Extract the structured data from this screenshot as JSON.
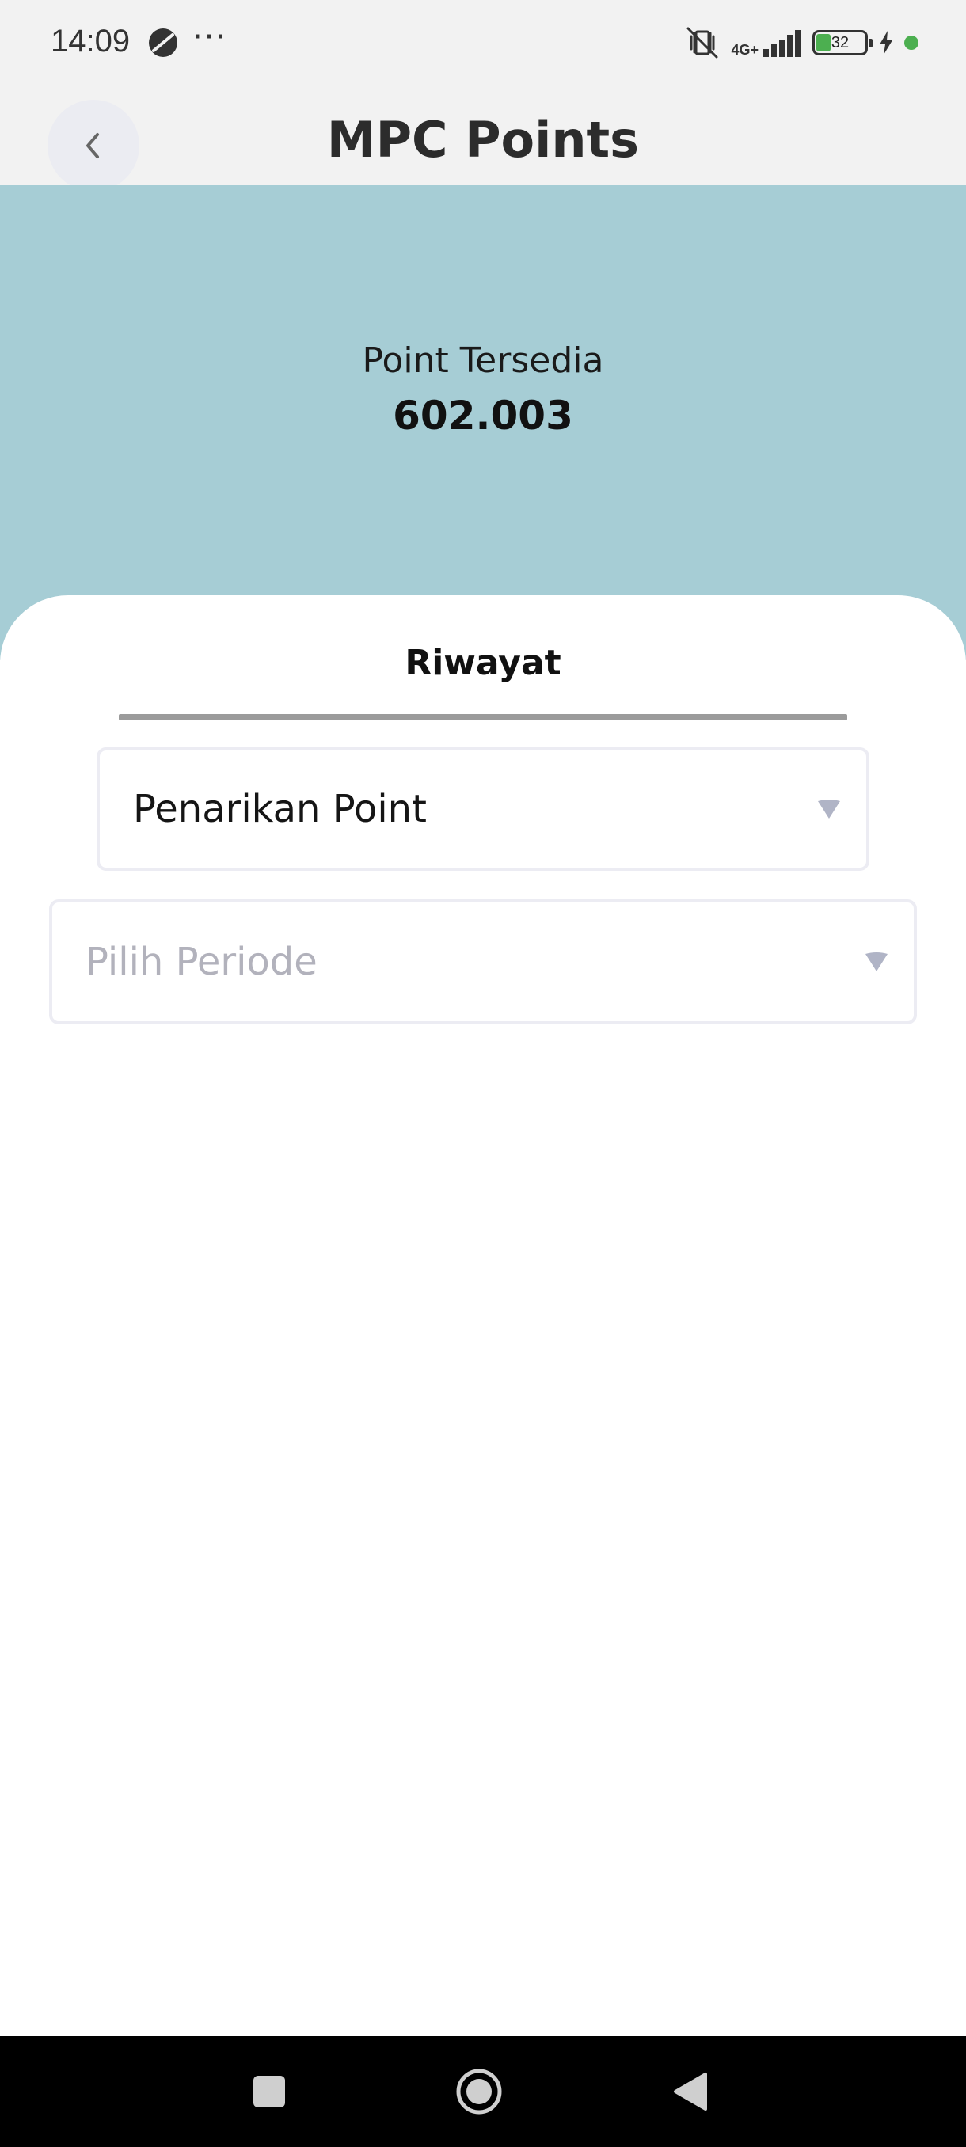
{
  "status_bar": {
    "time": "14:09",
    "more": "···",
    "network": "4G+",
    "battery": "32",
    "icons": [
      "app-icon",
      "silent-icon",
      "signal-icon",
      "battery-icon",
      "charging-icon"
    ]
  },
  "header": {
    "title": "MPC Points",
    "back_icon": "chevron-left-icon"
  },
  "points": {
    "label": "Point Tersedia",
    "value": "602.003"
  },
  "tabs": {
    "history_label": "Riwayat"
  },
  "filters": {
    "type_selected": "Penarikan Point",
    "period_placeholder": "Pilih Periode"
  },
  "colors": {
    "hero_bg": "#a6cdd5",
    "bar_bg": "#f2f2f2",
    "indicator": "#9b9b9b",
    "caret": "#b0b4c6",
    "battery": "#4caf50"
  }
}
